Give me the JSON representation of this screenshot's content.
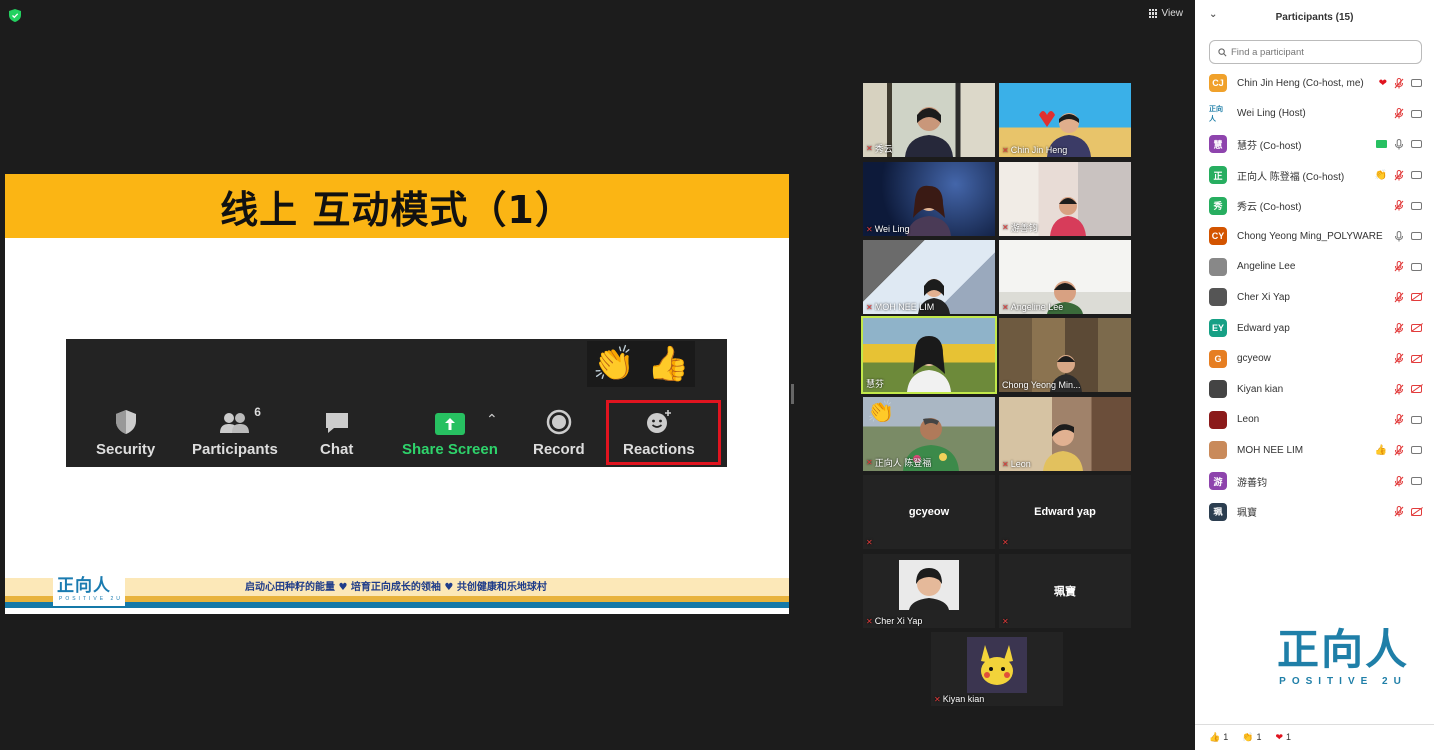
{
  "top": {
    "view_label": "View"
  },
  "slide": {
    "title": "线上 互动模式（1）",
    "toolbar": {
      "security": "Security",
      "participants": "Participants",
      "participants_count": "6",
      "chat": "Chat",
      "share_screen": "Share Screen",
      "record": "Record",
      "reactions": "Reactions",
      "emoji1": "👏",
      "emoji2": "👍"
    },
    "footer_logo": "正向人",
    "footer_logo_sub": "POSITIVE 2U",
    "footer_text": "启动心田种籽的能量 ♥ 培育正向成长的领袖 ♥ 共创健康和乐地球村"
  },
  "videos": [
    {
      "name": "秀云"
    },
    {
      "name": "Chin Jin Heng"
    },
    {
      "name": "Wei Ling"
    },
    {
      "name": "游善钧"
    },
    {
      "name": "MOH NEE LIM"
    },
    {
      "name": "Angeline Lee"
    },
    {
      "name": "慧芬"
    },
    {
      "name": "Chong Yeong Min..."
    },
    {
      "name": "正向人 陈登福",
      "emoji": "👏"
    },
    {
      "name": "Leon"
    },
    {
      "name": "gcyeow"
    },
    {
      "name": "Edward yap"
    },
    {
      "name": "Cher Xi Yap"
    },
    {
      "name": "珮寶"
    },
    {
      "name": "Kiyan kian"
    }
  ],
  "panel": {
    "title": "Participants (15)",
    "search_placeholder": "Find a participant",
    "participants": [
      {
        "initials": "CJ",
        "color": "#f0a12b",
        "name": "Chin Jin Heng (Co-host, me)",
        "reaction": "❤",
        "mic": "off",
        "cam": "on"
      },
      {
        "initials": "正向人",
        "color": "#ffffff",
        "name": "Wei Ling (Host)",
        "reaction": "",
        "mic": "off",
        "cam": "on"
      },
      {
        "initials": "慧",
        "color": "#8e44ad",
        "name": "慧芬 (Co-host)",
        "reaction": "",
        "mic": "on",
        "cam": "on",
        "share": true
      },
      {
        "initials": "正",
        "color": "#27ae60",
        "name": "正向人 陈登福 (Co-host)",
        "reaction": "👏",
        "mic": "off",
        "cam": "on"
      },
      {
        "initials": "秀",
        "color": "#27ae60",
        "name": "秀云 (Co-host)",
        "reaction": "",
        "mic": "off",
        "cam": "on"
      },
      {
        "initials": "CY",
        "color": "#d35400",
        "name": "Chong Yeong Ming_POLYWARE",
        "reaction": "",
        "mic": "on",
        "cam": "on"
      },
      {
        "initials": "",
        "color": "#888888",
        "name": "Angeline Lee",
        "reaction": "",
        "mic": "off",
        "cam": "on"
      },
      {
        "initials": "",
        "color": "#555555",
        "name": "Cher Xi Yap",
        "reaction": "",
        "mic": "off",
        "cam": "off"
      },
      {
        "initials": "EY",
        "color": "#16a085",
        "name": "Edward yap",
        "reaction": "",
        "mic": "off",
        "cam": "off"
      },
      {
        "initials": "G",
        "color": "#e67e22",
        "name": "gcyeow",
        "reaction": "",
        "mic": "off",
        "cam": "off"
      },
      {
        "initials": "",
        "color": "#444444",
        "name": "Kiyan kian",
        "reaction": "",
        "mic": "off",
        "cam": "off"
      },
      {
        "initials": "",
        "color": "#8b1a1a",
        "name": "Leon",
        "reaction": "",
        "mic": "off",
        "cam": "on"
      },
      {
        "initials": "",
        "color": "#c98a5a",
        "name": "MOH NEE LIM",
        "reaction": "👍",
        "mic": "off",
        "cam": "on"
      },
      {
        "initials": "游",
        "color": "#8e44ad",
        "name": "游善钧",
        "reaction": "",
        "mic": "off",
        "cam": "on"
      },
      {
        "initials": "珮",
        "color": "#2c3e50",
        "name": "珮寶",
        "reaction": "",
        "mic": "off",
        "cam": "off"
      }
    ],
    "logo_main": "正向人",
    "logo_sub": "POSITIVE 2U",
    "reaction_counts": [
      {
        "emoji": "👍",
        "count": "1"
      },
      {
        "emoji": "👏",
        "count": "1"
      },
      {
        "emoji": "❤",
        "count": "1"
      }
    ]
  },
  "colors": {
    "accent_green": "#2ed36b",
    "highlight_red": "#e0141f",
    "slide_yellow": "#fbb514"
  }
}
